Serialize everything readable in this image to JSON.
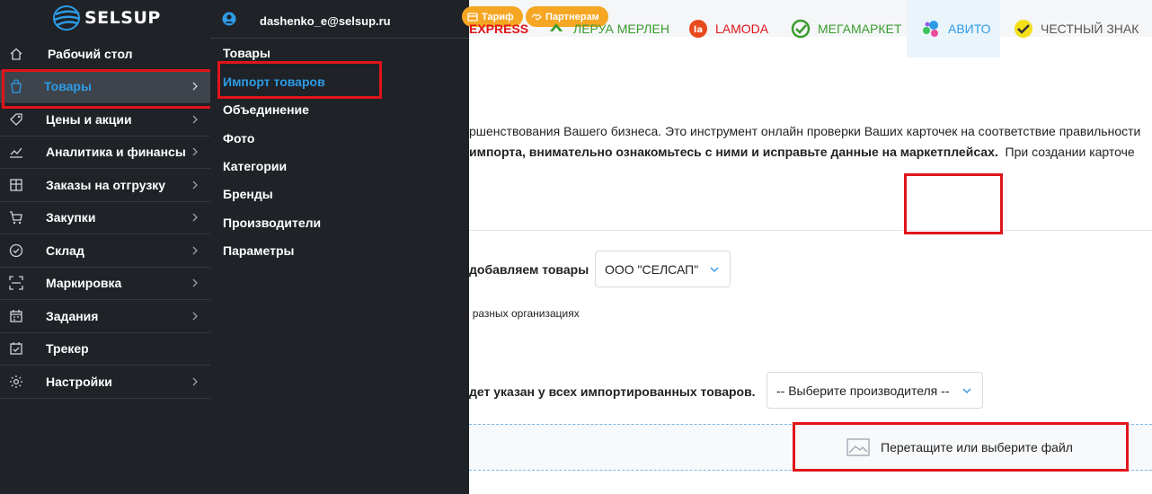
{
  "logo": {
    "text": "SELSUP"
  },
  "sidebar": {
    "items": [
      {
        "label": "Рабочий стол",
        "icon": "home-icon",
        "has_submenu": false
      },
      {
        "label": "Товары",
        "icon": "bag-icon",
        "has_submenu": true,
        "active": true
      },
      {
        "label": "Цены и акции",
        "icon": "tag-icon",
        "has_submenu": true
      },
      {
        "label": "Аналитика и финансы",
        "icon": "chart-icon",
        "has_submenu": true
      },
      {
        "label": "Заказы на отгрузку",
        "icon": "box-icon",
        "has_submenu": true
      },
      {
        "label": "Закупки",
        "icon": "cart-icon",
        "has_submenu": true
      },
      {
        "label": "Склад",
        "icon": "check-circle-icon",
        "has_submenu": true
      },
      {
        "label": "Маркировка",
        "icon": "scan-icon",
        "has_submenu": true
      },
      {
        "label": "Задания",
        "icon": "calendar-icon",
        "has_submenu": true
      },
      {
        "label": "Трекер",
        "icon": "calendar-check-icon",
        "has_submenu": false
      },
      {
        "label": "Настройки",
        "icon": "gear-icon",
        "has_submenu": true
      }
    ]
  },
  "submenu": {
    "user_email": "dashenko_e@selsup.ru",
    "items": [
      {
        "label": "Товары"
      },
      {
        "label": "Импорт товаров",
        "active": true
      },
      {
        "label": "Объединение"
      },
      {
        "label": "Фото"
      },
      {
        "label": "Категории"
      },
      {
        "label": "Бренды"
      },
      {
        "label": "Производители"
      },
      {
        "label": "Параметры"
      }
    ]
  },
  "topbar": {
    "tariff_label": "Тариф",
    "partners_label": "Партнерам"
  },
  "main": {
    "description_line1": "ршенствования Вашего бизнеса. Это инструмент онлайн проверки Ваших карточек на соответствие правильности",
    "description_line2_bold": "импорта, внимательно ознакомьтесь с ними и исправьте данные на маркетплейсах.",
    "description_line2_rest": "При создании карточе",
    "tabs": [
      {
        "label": "EXPRESS",
        "color": "#e0151b"
      },
      {
        "label": "ЛЕРУА МЕРЛЕН",
        "color": "#3a9b2f"
      },
      {
        "label": "LAMODA",
        "color": "#e0151b"
      },
      {
        "label": "МЕГАМАРКЕТ",
        "color": "#3a9b2f"
      },
      {
        "label": "АВИТО",
        "color": "#2d9be6",
        "active": true
      },
      {
        "label": "ЧЕСТНЫЙ ЗНАК",
        "color": "#555555"
      }
    ],
    "org_label": "добавляем товары",
    "org_value": "ООО \"СЕЛСАП\"",
    "org_note": "в разных организациях",
    "manufacturer_label": "дет указан у всех импортированных товаров.",
    "manufacturer_placeholder": "-- Выберите производителя --",
    "dropzone_text": "Перетащите или выберите файл"
  }
}
